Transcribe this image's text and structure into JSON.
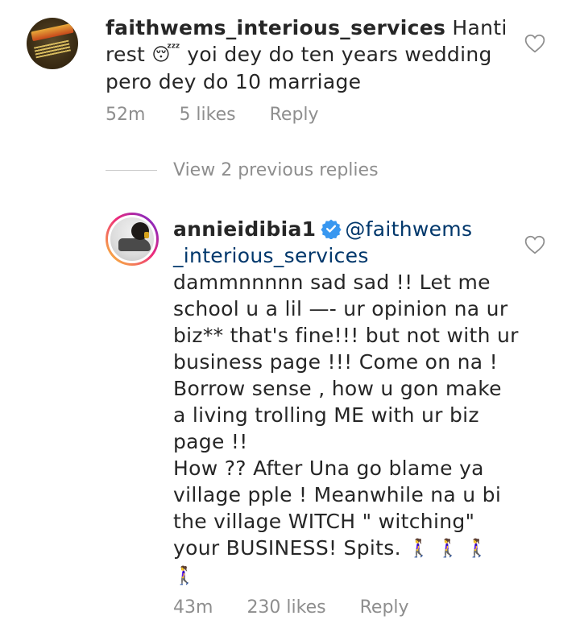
{
  "comments": [
    {
      "avatar_icon": "faithwems-logo-avatar",
      "username": "faithwems_interious_services",
      "text_line1": "Hanti",
      "text_line2_a": "rest",
      "emoji": "😴",
      "text_line2_b": "yoi dey do ten years wedding",
      "text_line3": "pero dey do 10 marriage",
      "time": "52m",
      "likes": "5 likes",
      "reply_label": "Reply",
      "heart_icon": "heart-outline-icon"
    },
    {
      "avatar_icon": "annieidibia-avatar",
      "username": "annieidibia1",
      "verified_icon": "verified-badge-icon",
      "mention_line1": "@faithwems",
      "mention_line2": "_interious_services",
      "body_lines": [
        "dammnnnnn sad sad !! Let me",
        "school u a lil —- ur opinion na ur",
        "biz** that's fine!!! but  not with ur",
        "business page !!! Come on na !",
        "Borrow sense , how u gon make",
        "a living trolling ME with ur biz",
        "page !!",
        "How ?? After  Una go blame ya",
        "village pple ! Meanwhile na u bi",
        "the village WITCH \" witching\""
      ],
      "last_line_text": "your BUSINESS! Spits.",
      "walking_emojis": [
        "🚶‍♀️",
        "🚶‍♀️",
        "🚶‍♀️",
        "🚶‍♀️"
      ],
      "time": "43m",
      "likes": "230 likes",
      "reply_label": "Reply",
      "heart_icon": "heart-outline-icon"
    }
  ],
  "view_replies_label": "View 2 previous replies",
  "colors": {
    "text": "#262626",
    "meta": "#8e8e8e",
    "mention": "#00376b",
    "verified": "#3897f0"
  }
}
